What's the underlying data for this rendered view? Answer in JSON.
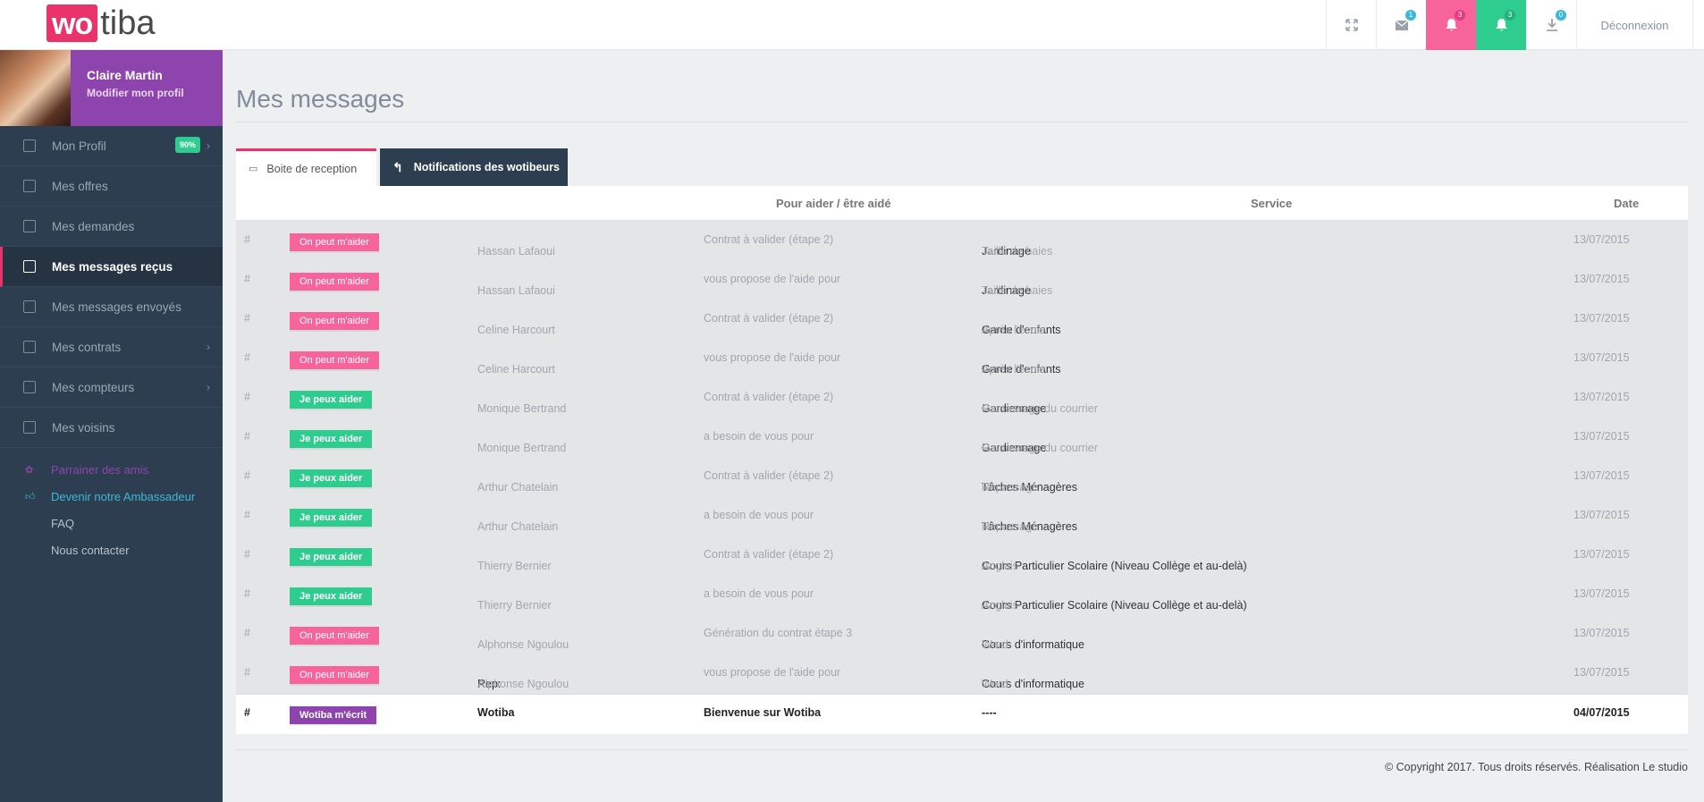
{
  "header": {
    "logo_highlight": "wo",
    "logo_rest": "tiba",
    "icons": [
      {
        "name": "expand-icon",
        "badge": ""
      },
      {
        "name": "envelope-icon",
        "badge": "1"
      },
      {
        "name": "bell-icon",
        "badge": "3",
        "color": "#f6649b"
      },
      {
        "name": "bell-icon",
        "badge": "3",
        "color": "#2ecc8f"
      },
      {
        "name": "download-icon",
        "badge": "0"
      }
    ],
    "logout_label": "Déconnexion"
  },
  "sidebar": {
    "user_name": "Claire Martin",
    "edit_profile": "Modifier mon profil",
    "profile_percent": "90%",
    "items": [
      {
        "label": "Mon Profil",
        "icon": "user-icon"
      },
      {
        "label": "Mes offres",
        "icon": "offers-icon"
      },
      {
        "label": "Mes demandes",
        "icon": "requests-icon"
      },
      {
        "label": "Mes messages reçus",
        "icon": "inbox-icon",
        "active": true
      },
      {
        "label": "Mes messages envoyés",
        "icon": "sent-icon"
      },
      {
        "label": "Mes contrats",
        "icon": "contracts-icon"
      },
      {
        "label": "Mes compteurs",
        "icon": "counters-icon"
      },
      {
        "label": "Mes voisins",
        "icon": "neighbors-icon"
      }
    ],
    "links": [
      "Parrainer des amis",
      "Devenir notre Ambassadeur",
      "FAQ",
      "Nous contacter"
    ]
  },
  "main": {
    "title": "Mes messages",
    "tabs": [
      "Boite de reception",
      "Notifications des wotibeurs"
    ],
    "columns": {
      "who": "Pour aider / être aidé",
      "service": "Service",
      "date": "Date"
    },
    "rows": [
      {
        "hash": "#",
        "tag": "On peut m'aider",
        "tag_type": "pink",
        "prefix": "",
        "name": "Hassan Lafaoui",
        "msg": "Contrat à valider (étape 2)",
        "svc_main": "Jardinage",
        "svc_sub": "Taille de haies",
        "date": "13/07/2015"
      },
      {
        "hash": "#",
        "tag": "On peut m'aider",
        "tag_type": "pink",
        "prefix": "",
        "name": "Hassan Lafaoui",
        "msg": "vous propose de l'aide pour",
        "svc_main": "Jardinage",
        "svc_sub": "Taille de haies",
        "date": "13/07/2015"
      },
      {
        "hash": "#",
        "tag": "On peut m'aider",
        "tag_type": "pink",
        "prefix": "",
        "name": "Celine Harcourt",
        "msg": "Contrat à valider (étape 2)",
        "svc_main": "Garde d'enfants",
        "svc_sub": "Après l'école",
        "date": "13/07/2015"
      },
      {
        "hash": "#",
        "tag": "On peut m'aider",
        "tag_type": "pink",
        "prefix": "",
        "name": "Celine Harcourt",
        "msg": "vous propose de l'aide pour",
        "svc_main": "Garde d'enfants",
        "svc_sub": "Après l'école",
        "date": "13/07/2015"
      },
      {
        "hash": "#",
        "tag": "Je peux aider",
        "tag_type": "green",
        "prefix": "",
        "name": "Monique Bertrand",
        "msg": "Contrat à valider (étape 2)",
        "svc_main": "Gardiennage",
        "svc_sub": "Ramassage du courrier",
        "date": "13/07/2015"
      },
      {
        "hash": "#",
        "tag": "Je peux aider",
        "tag_type": "green",
        "prefix": "",
        "name": "Monique Bertrand",
        "msg": "a besoin de vous pour",
        "svc_main": "Gardiennage",
        "svc_sub": "Ramassage du courrier",
        "date": "13/07/2015"
      },
      {
        "hash": "#",
        "tag": "Je peux aider",
        "tag_type": "green",
        "prefix": "",
        "name": "Arthur Chatelain",
        "msg": "Contrat à valider (étape 2)",
        "svc_main": "Tâches Ménagères",
        "svc_sub": "Repassage",
        "date": "13/07/2015"
      },
      {
        "hash": "#",
        "tag": "Je peux aider",
        "tag_type": "green",
        "prefix": "",
        "name": "Arthur Chatelain",
        "msg": "a besoin de vous pour",
        "svc_main": "Tâches Ménagères",
        "svc_sub": "Repassage",
        "date": "13/07/2015"
      },
      {
        "hash": "#",
        "tag": "Je peux aider",
        "tag_type": "green",
        "prefix": "",
        "name": "Thierry Bernier",
        "msg": "Contrat à valider (étape 2)",
        "svc_main": "Cours Particulier Scolaire (Niveau Collège et au-delà)",
        "svc_sub": "Anglais",
        "date": "13/07/2015"
      },
      {
        "hash": "#",
        "tag": "Je peux aider",
        "tag_type": "green",
        "prefix": "",
        "name": "Thierry Bernier",
        "msg": "a besoin de vous pour",
        "svc_main": "Cours Particulier Scolaire (Niveau Collège et au-delà)",
        "svc_sub": "Anglais",
        "date": "13/07/2015"
      },
      {
        "hash": "#",
        "tag": "On peut m'aider",
        "tag_type": "pink",
        "prefix": "",
        "name": "Alphonse Ngoulou",
        "msg": "Génération du contrat étape 3",
        "svc_main": "Cours d'informatique",
        "svc_sub": "Word",
        "date": "13/07/2015"
      },
      {
        "hash": "#",
        "tag": "On peut m'aider",
        "tag_type": "pink",
        "prefix": "Rep: ",
        "name": "Alphonse Ngoulou",
        "msg": "vous propose de l'aide pour",
        "svc_main": "Cours d'informatique",
        "svc_sub": "Word",
        "date": "13/07/2015"
      }
    ],
    "last_row": {
      "hash": "#",
      "tag": "Wotiba m'écrit",
      "name": "Wotiba",
      "msg": "Bienvenue sur Wotiba",
      "svc": "----",
      "date": "04/07/2015"
    },
    "arrow": "→"
  },
  "footer": "© Copyright 2017. Tous droits réservés. Réalisation Le studio"
}
